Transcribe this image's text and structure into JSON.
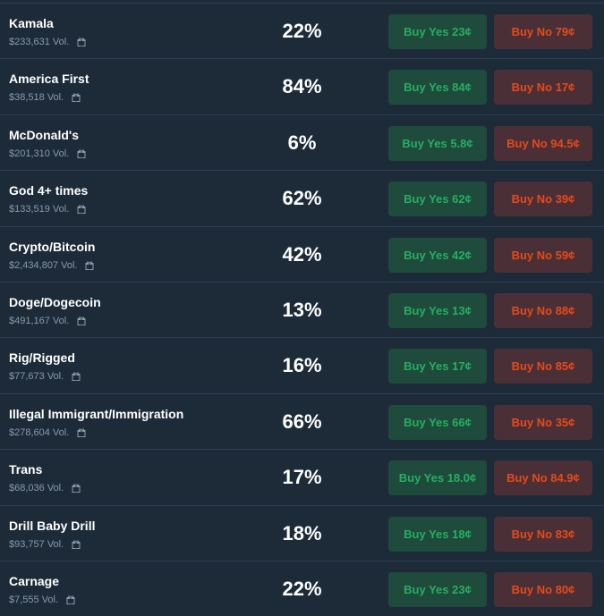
{
  "colors": {
    "background": "#1d2b39",
    "divider": "#2c3f52",
    "yes_bg": "#1e4b3c",
    "yes_text": "#27ae60",
    "no_bg": "#4b2f37",
    "no_text": "#e64a19",
    "volume_text": "#889aab"
  },
  "markets": [
    {
      "name": "Kamala",
      "volume": "$233,631 Vol.",
      "icon": "gift-icon",
      "percent": "22%",
      "buy_yes": "Buy Yes 23¢",
      "buy_no": "Buy No 79¢"
    },
    {
      "name": "America First",
      "volume": "$38,518 Vol.",
      "icon": "gift-icon",
      "percent": "84%",
      "buy_yes": "Buy Yes 84¢",
      "buy_no": "Buy No 17¢"
    },
    {
      "name": "McDonald's",
      "volume": "$201,310 Vol.",
      "icon": "gift-icon",
      "percent": "6%",
      "buy_yes": "Buy Yes 5.8¢",
      "buy_no": "Buy No 94.5¢"
    },
    {
      "name": "God 4+ times",
      "volume": "$133,519 Vol.",
      "icon": "gift-icon",
      "percent": "62%",
      "buy_yes": "Buy Yes 62¢",
      "buy_no": "Buy No 39¢"
    },
    {
      "name": "Crypto/Bitcoin",
      "volume": "$2,434,807 Vol.",
      "icon": "gift-icon",
      "percent": "42%",
      "buy_yes": "Buy Yes 42¢",
      "buy_no": "Buy No 59¢"
    },
    {
      "name": "Doge/Dogecoin",
      "volume": "$491,167 Vol.",
      "icon": "gift-icon",
      "percent": "13%",
      "buy_yes": "Buy Yes 13¢",
      "buy_no": "Buy No 88¢"
    },
    {
      "name": "Rig/Rigged",
      "volume": "$77,673 Vol.",
      "icon": "gift-icon",
      "percent": "16%",
      "buy_yes": "Buy Yes 17¢",
      "buy_no": "Buy No 85¢"
    },
    {
      "name": "Illegal Immigrant/Immigration",
      "volume": "$278,604 Vol.",
      "icon": "gift-icon",
      "percent": "66%",
      "buy_yes": "Buy Yes 66¢",
      "buy_no": "Buy No 35¢"
    },
    {
      "name": "Trans",
      "volume": "$68,036 Vol.",
      "icon": "gift-icon",
      "percent": "17%",
      "buy_yes": "Buy Yes 18.0¢",
      "buy_no": "Buy No 84.9¢"
    },
    {
      "name": "Drill Baby Drill",
      "volume": "$93,757 Vol.",
      "icon": "gift-icon",
      "percent": "18%",
      "buy_yes": "Buy Yes 18¢",
      "buy_no": "Buy No 83¢"
    },
    {
      "name": "Carnage",
      "volume": "$7,555 Vol.",
      "icon": "gift-icon",
      "percent": "22%",
      "buy_yes": "Buy Yes 23¢",
      "buy_no": "Buy No 80¢"
    }
  ]
}
